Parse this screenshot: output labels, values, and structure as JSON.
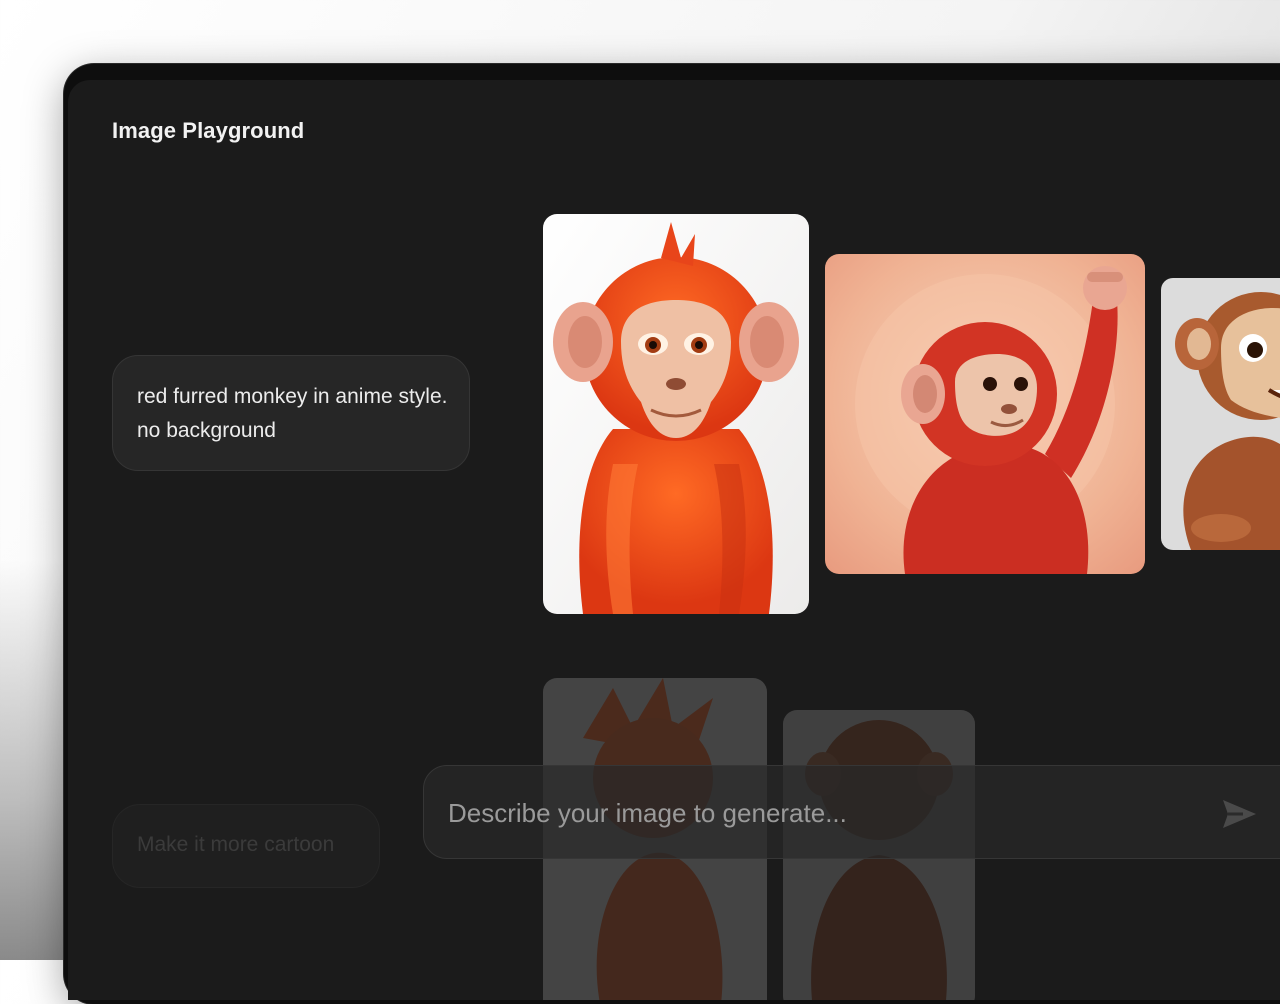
{
  "app": {
    "title": "Image Playground"
  },
  "conversation": {
    "prompt_lines": [
      "red furred monkey in anime style.",
      "no background"
    ]
  },
  "results": {
    "images": [
      {
        "subject": "red furred monkey, front-facing portrait, white background"
      },
      {
        "subject": "red monkey raising fist, peach background"
      },
      {
        "subject": "cartoon brown monkey smiling, partially visible"
      }
    ],
    "next_images": [
      {
        "subject": "cartoon monkey with spiky hair, faded"
      },
      {
        "subject": "cartoon monkey, faded"
      }
    ]
  },
  "suggestions": [
    {
      "label": "Make it more cartoon"
    }
  ],
  "composer": {
    "placeholder": "Describe your image to generate...",
    "send_icon": "paper-plane-icon"
  },
  "colors": {
    "screen_bg": "#1b1b1b",
    "bubble_bg": "#262626",
    "text_primary": "#f2f2f2",
    "monkey_red": "#e8471c"
  }
}
